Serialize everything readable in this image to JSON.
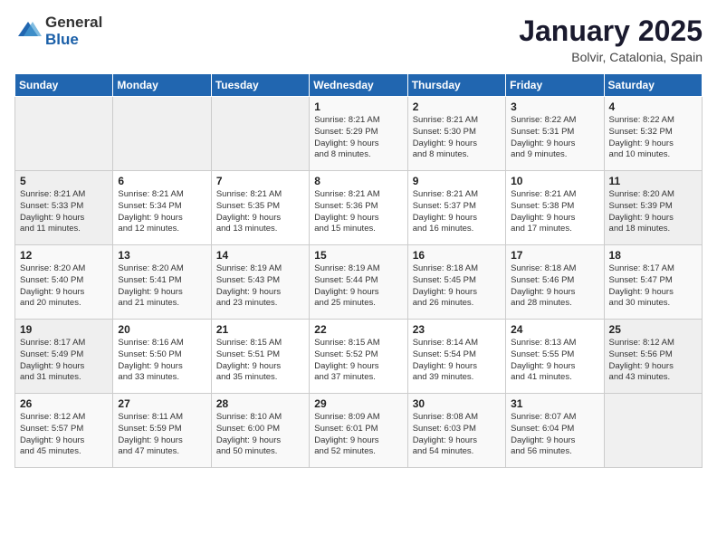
{
  "header": {
    "logo_general": "General",
    "logo_blue": "Blue",
    "month_title": "January 2025",
    "location": "Bolvir, Catalonia, Spain"
  },
  "days_of_week": [
    "Sunday",
    "Monday",
    "Tuesday",
    "Wednesday",
    "Thursday",
    "Friday",
    "Saturday"
  ],
  "weeks": [
    [
      {
        "day": "",
        "content": ""
      },
      {
        "day": "",
        "content": ""
      },
      {
        "day": "",
        "content": ""
      },
      {
        "day": "1",
        "content": "Sunrise: 8:21 AM\nSunset: 5:29 PM\nDaylight: 9 hours\nand 8 minutes."
      },
      {
        "day": "2",
        "content": "Sunrise: 8:21 AM\nSunset: 5:30 PM\nDaylight: 9 hours\nand 8 minutes."
      },
      {
        "day": "3",
        "content": "Sunrise: 8:22 AM\nSunset: 5:31 PM\nDaylight: 9 hours\nand 9 minutes."
      },
      {
        "day": "4",
        "content": "Sunrise: 8:22 AM\nSunset: 5:32 PM\nDaylight: 9 hours\nand 10 minutes."
      }
    ],
    [
      {
        "day": "5",
        "content": "Sunrise: 8:21 AM\nSunset: 5:33 PM\nDaylight: 9 hours\nand 11 minutes."
      },
      {
        "day": "6",
        "content": "Sunrise: 8:21 AM\nSunset: 5:34 PM\nDaylight: 9 hours\nand 12 minutes."
      },
      {
        "day": "7",
        "content": "Sunrise: 8:21 AM\nSunset: 5:35 PM\nDaylight: 9 hours\nand 13 minutes."
      },
      {
        "day": "8",
        "content": "Sunrise: 8:21 AM\nSunset: 5:36 PM\nDaylight: 9 hours\nand 15 minutes."
      },
      {
        "day": "9",
        "content": "Sunrise: 8:21 AM\nSunset: 5:37 PM\nDaylight: 9 hours\nand 16 minutes."
      },
      {
        "day": "10",
        "content": "Sunrise: 8:21 AM\nSunset: 5:38 PM\nDaylight: 9 hours\nand 17 minutes."
      },
      {
        "day": "11",
        "content": "Sunrise: 8:20 AM\nSunset: 5:39 PM\nDaylight: 9 hours\nand 18 minutes."
      }
    ],
    [
      {
        "day": "12",
        "content": "Sunrise: 8:20 AM\nSunset: 5:40 PM\nDaylight: 9 hours\nand 20 minutes."
      },
      {
        "day": "13",
        "content": "Sunrise: 8:20 AM\nSunset: 5:41 PM\nDaylight: 9 hours\nand 21 minutes."
      },
      {
        "day": "14",
        "content": "Sunrise: 8:19 AM\nSunset: 5:43 PM\nDaylight: 9 hours\nand 23 minutes."
      },
      {
        "day": "15",
        "content": "Sunrise: 8:19 AM\nSunset: 5:44 PM\nDaylight: 9 hours\nand 25 minutes."
      },
      {
        "day": "16",
        "content": "Sunrise: 8:18 AM\nSunset: 5:45 PM\nDaylight: 9 hours\nand 26 minutes."
      },
      {
        "day": "17",
        "content": "Sunrise: 8:18 AM\nSunset: 5:46 PM\nDaylight: 9 hours\nand 28 minutes."
      },
      {
        "day": "18",
        "content": "Sunrise: 8:17 AM\nSunset: 5:47 PM\nDaylight: 9 hours\nand 30 minutes."
      }
    ],
    [
      {
        "day": "19",
        "content": "Sunrise: 8:17 AM\nSunset: 5:49 PM\nDaylight: 9 hours\nand 31 minutes."
      },
      {
        "day": "20",
        "content": "Sunrise: 8:16 AM\nSunset: 5:50 PM\nDaylight: 9 hours\nand 33 minutes."
      },
      {
        "day": "21",
        "content": "Sunrise: 8:15 AM\nSunset: 5:51 PM\nDaylight: 9 hours\nand 35 minutes."
      },
      {
        "day": "22",
        "content": "Sunrise: 8:15 AM\nSunset: 5:52 PM\nDaylight: 9 hours\nand 37 minutes."
      },
      {
        "day": "23",
        "content": "Sunrise: 8:14 AM\nSunset: 5:54 PM\nDaylight: 9 hours\nand 39 minutes."
      },
      {
        "day": "24",
        "content": "Sunrise: 8:13 AM\nSunset: 5:55 PM\nDaylight: 9 hours\nand 41 minutes."
      },
      {
        "day": "25",
        "content": "Sunrise: 8:12 AM\nSunset: 5:56 PM\nDaylight: 9 hours\nand 43 minutes."
      }
    ],
    [
      {
        "day": "26",
        "content": "Sunrise: 8:12 AM\nSunset: 5:57 PM\nDaylight: 9 hours\nand 45 minutes."
      },
      {
        "day": "27",
        "content": "Sunrise: 8:11 AM\nSunset: 5:59 PM\nDaylight: 9 hours\nand 47 minutes."
      },
      {
        "day": "28",
        "content": "Sunrise: 8:10 AM\nSunset: 6:00 PM\nDaylight: 9 hours\nand 50 minutes."
      },
      {
        "day": "29",
        "content": "Sunrise: 8:09 AM\nSunset: 6:01 PM\nDaylight: 9 hours\nand 52 minutes."
      },
      {
        "day": "30",
        "content": "Sunrise: 8:08 AM\nSunset: 6:03 PM\nDaylight: 9 hours\nand 54 minutes."
      },
      {
        "day": "31",
        "content": "Sunrise: 8:07 AM\nSunset: 6:04 PM\nDaylight: 9 hours\nand 56 minutes."
      },
      {
        "day": "",
        "content": ""
      }
    ]
  ]
}
